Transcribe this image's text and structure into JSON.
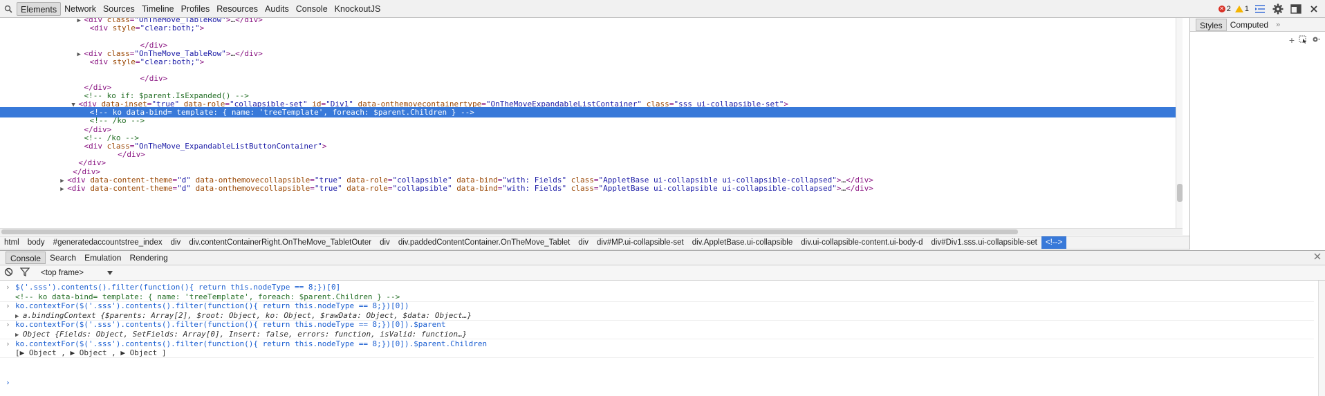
{
  "toolbar": {
    "tabs": [
      "Elements",
      "Network",
      "Sources",
      "Timeline",
      "Profiles",
      "Resources",
      "Audits",
      "Console",
      "KnockoutJS"
    ],
    "error_count": "2",
    "warning_count": "1"
  },
  "tree": {
    "lines": [
      {
        "indent": 15,
        "tri": "▶",
        "parts": [
          [
            "tag",
            "<div "
          ],
          [
            "attr",
            "class"
          ],
          [
            "tag",
            "="
          ],
          [
            "val",
            "\"OnTheMove_TableRow\""
          ],
          [
            "tag",
            ">"
          ],
          [
            "out",
            "…"
          ],
          [
            "tag",
            "</div>"
          ]
        ]
      },
      {
        "indent": 16,
        "tri": "",
        "parts": [
          [
            "tag",
            "<div "
          ],
          [
            "attr",
            "style"
          ],
          [
            "tag",
            "="
          ],
          [
            "val",
            "\"clear:both;\""
          ],
          [
            "tag",
            ">"
          ]
        ]
      },
      {
        "indent": 0,
        "tri": "",
        "parts": []
      },
      {
        "indent": 25,
        "tri": "",
        "parts": [
          [
            "tag",
            "</div>"
          ]
        ]
      },
      {
        "indent": 15,
        "tri": "▶",
        "parts": [
          [
            "tag",
            "<div "
          ],
          [
            "attr",
            "class"
          ],
          [
            "tag",
            "="
          ],
          [
            "val",
            "\"OnTheMove_TableRow\""
          ],
          [
            "tag",
            ">"
          ],
          [
            "out",
            "…"
          ],
          [
            "tag",
            "</div>"
          ]
        ]
      },
      {
        "indent": 16,
        "tri": "",
        "parts": [
          [
            "tag",
            "<div "
          ],
          [
            "attr",
            "style"
          ],
          [
            "tag",
            "="
          ],
          [
            "val",
            "\"clear:both;\""
          ],
          [
            "tag",
            ">"
          ]
        ]
      },
      {
        "indent": 0,
        "tri": "",
        "parts": []
      },
      {
        "indent": 25,
        "tri": "",
        "parts": [
          [
            "tag",
            "</div>"
          ]
        ]
      },
      {
        "indent": 15,
        "tri": "",
        "parts": [
          [
            "tag",
            "</div>"
          ]
        ]
      },
      {
        "indent": 15,
        "tri": "",
        "parts": [
          [
            "cmt",
            "<!-- ko if: $parent.IsExpanded() -->"
          ]
        ]
      },
      {
        "indent": 14,
        "tri": "▼",
        "parts": [
          [
            "tag",
            "<div "
          ],
          [
            "attr",
            "data-inset"
          ],
          [
            "tag",
            "="
          ],
          [
            "val",
            "\"true\""
          ],
          [
            "tag",
            " "
          ],
          [
            "attr",
            "data-role"
          ],
          [
            "tag",
            "="
          ],
          [
            "val",
            "\"collapsible-set\""
          ],
          [
            "tag",
            " "
          ],
          [
            "attr",
            "id"
          ],
          [
            "tag",
            "="
          ],
          [
            "val",
            "\"Div1\""
          ],
          [
            "tag",
            " "
          ],
          [
            "attr",
            "data-onthemovecontainertype"
          ],
          [
            "tag",
            "="
          ],
          [
            "val",
            "\"OnTheMoveExpandableListContainer\""
          ],
          [
            "tag",
            " "
          ],
          [
            "attr",
            "class"
          ],
          [
            "tag",
            "="
          ],
          [
            "val",
            "\"sss ui-collapsible-set\""
          ],
          [
            "tag",
            ">"
          ]
        ]
      },
      {
        "indent": 16,
        "tri": "",
        "sel": true,
        "parts": [
          [
            "cmt",
            "<!-- ko data-bind= template: { name: 'treeTemplate', foreach: $parent.Children } -->"
          ]
        ]
      },
      {
        "indent": 16,
        "tri": "",
        "parts": [
          [
            "cmt",
            "<!-- /ko -->"
          ]
        ]
      },
      {
        "indent": 15,
        "tri": "",
        "parts": [
          [
            "tag",
            "</div>"
          ]
        ]
      },
      {
        "indent": 15,
        "tri": "",
        "parts": [
          [
            "cmt",
            "<!-- /ko -->"
          ]
        ]
      },
      {
        "indent": 15,
        "tri": "",
        "parts": [
          [
            "tag",
            "<div "
          ],
          [
            "attr",
            "class"
          ],
          [
            "tag",
            "="
          ],
          [
            "val",
            "\"OnTheMove_ExpandableListButtonContainer\""
          ],
          [
            "tag",
            ">"
          ]
        ]
      },
      {
        "indent": 21,
        "tri": "",
        "parts": [
          [
            "tag",
            "</div>"
          ]
        ]
      },
      {
        "indent": 14,
        "tri": "",
        "parts": [
          [
            "tag",
            "</div>"
          ]
        ]
      },
      {
        "indent": 13,
        "tri": "",
        "parts": [
          [
            "tag",
            "</div>"
          ]
        ]
      },
      {
        "indent": 12,
        "tri": "▶",
        "parts": [
          [
            "tag",
            "<div "
          ],
          [
            "attr",
            "data-content-theme"
          ],
          [
            "tag",
            "="
          ],
          [
            "val",
            "\"d\""
          ],
          [
            "tag",
            " "
          ],
          [
            "attr",
            "data-onthemovecollapsible"
          ],
          [
            "tag",
            "="
          ],
          [
            "val",
            "\"true\""
          ],
          [
            "tag",
            " "
          ],
          [
            "attr",
            "data-role"
          ],
          [
            "tag",
            "="
          ],
          [
            "val",
            "\"collapsible\""
          ],
          [
            "tag",
            " "
          ],
          [
            "attr",
            "data-bind"
          ],
          [
            "tag",
            "="
          ],
          [
            "val",
            "\"with: Fields\""
          ],
          [
            "tag",
            " "
          ],
          [
            "attr",
            "class"
          ],
          [
            "tag",
            "="
          ],
          [
            "val",
            "\"AppletBase ui-collapsible ui-collapsible-collapsed\""
          ],
          [
            "tag",
            ">"
          ],
          [
            "out",
            "…"
          ],
          [
            "tag",
            "</div>"
          ]
        ]
      },
      {
        "indent": 12,
        "tri": "▶",
        "parts": [
          [
            "tag",
            "<div "
          ],
          [
            "attr",
            "data-content-theme"
          ],
          [
            "tag",
            "="
          ],
          [
            "val",
            "\"d\""
          ],
          [
            "tag",
            " "
          ],
          [
            "attr",
            "data-onthemovecollapsible"
          ],
          [
            "tag",
            "="
          ],
          [
            "val",
            "\"true\""
          ],
          [
            "tag",
            " "
          ],
          [
            "attr",
            "data-role"
          ],
          [
            "tag",
            "="
          ],
          [
            "val",
            "\"collapsible\""
          ],
          [
            "tag",
            " "
          ],
          [
            "attr",
            "data-bind"
          ],
          [
            "tag",
            "="
          ],
          [
            "val",
            "\"with: Fields\""
          ],
          [
            "tag",
            " "
          ],
          [
            "attr",
            "class"
          ],
          [
            "tag",
            "="
          ],
          [
            "val",
            "\"AppletBase ui-collapsible ui-collapsible-collapsed\""
          ],
          [
            "tag",
            ">"
          ],
          [
            "out",
            "…"
          ],
          [
            "tag",
            "</div>"
          ]
        ]
      }
    ]
  },
  "breadcrumbs": [
    "html",
    "body",
    "#generatedaccountstree_index",
    "div",
    "div.contentContainerRight.OnTheMove_TabletOuter",
    "div",
    "div.paddedContentContainer.OnTheMove_Tablet",
    "div",
    "div#MP.ui-collapsible-set",
    "div.AppletBase.ui-collapsible",
    "div.ui-collapsible-content.ui-body-d",
    "div#Div1.sss.ui-collapsible-set",
    "<!-->"
  ],
  "sidebar": {
    "tabs": [
      "Styles",
      "Computed"
    ],
    "more": "»"
  },
  "drawer": {
    "tabs": [
      "Console",
      "Search",
      "Emulation",
      "Rendering"
    ],
    "frame_label": "<top frame>"
  },
  "console": {
    "entries": [
      {
        "type": "cmd",
        "text": "$('.sss').contents().filter(function(){ return this.nodeType == 8;})[0]"
      },
      {
        "type": "out",
        "text": "<!-- ko data-bind= template: { name: 'treeTemplate', foreach: $parent.Children } -->",
        "style": "cmt"
      },
      {
        "type": "cmd",
        "text": "ko.contextFor($('.sss').contents().filter(function(){ return this.nodeType == 8;})[0])"
      },
      {
        "type": "out",
        "tri": true,
        "text": "a.bindingContext {$parents: Array[2], $root: Object, ko: Object, $rawData: Object, $data: Object…}",
        "style": "ital"
      },
      {
        "type": "cmd",
        "text": "ko.contextFor($('.sss').contents().filter(function(){ return this.nodeType == 8;})[0]).$parent"
      },
      {
        "type": "out",
        "tri": true,
        "text": "Object {Fields: Object, SetFields: Array[0], Insert: false, errors: function, isValid: function…}",
        "style": "ital"
      },
      {
        "type": "cmd",
        "text": "ko.contextFor($('.sss').contents().filter(function(){ return this.nodeType == 8;})[0]).$parent.Children"
      },
      {
        "type": "out",
        "text": "[▶ Object , ▶ Object , ▶ Object ]",
        "style": "plain"
      }
    ]
  }
}
